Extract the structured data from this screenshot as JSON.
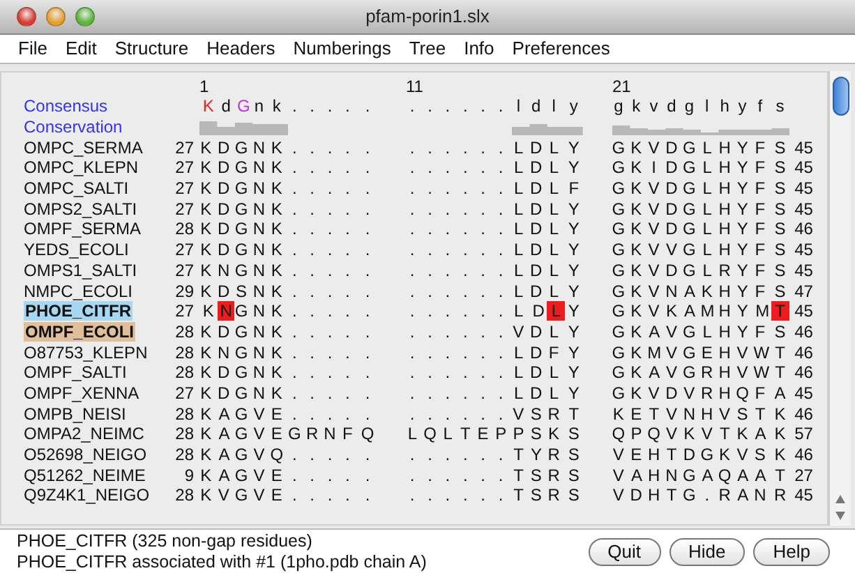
{
  "window": {
    "title": "pfam-porin1.slx"
  },
  "menu": [
    "File",
    "Edit",
    "Structure",
    "Headers",
    "Numberings",
    "Tree",
    "Info",
    "Preferences"
  ],
  "ruler": [
    "1",
    "11",
    "21"
  ],
  "consensus": {
    "label": "Consensus",
    "blocks": [
      [
        {
          "text": "K",
          "color": "#ee2222"
        },
        {
          "text": "d"
        },
        {
          "text": "G",
          "color": "#bb33dd"
        },
        {
          "text": "n k . . . . ."
        }
      ],
      [
        {
          "text": ". . . . . . l d l y"
        }
      ],
      [
        {
          "text": "g k v d g l h y f s"
        }
      ]
    ]
  },
  "conservation": {
    "label": "Conservation"
  },
  "rows": [
    {
      "name": "OMPC_SERMA",
      "start": "27",
      "blocks": [
        [
          {
            "text": "K D G N K . . . . ."
          }
        ],
        [
          {
            "text": ". . . . . . L D L Y"
          }
        ],
        [
          {
            "text": "G K V D G L H Y F S"
          }
        ]
      ],
      "end": "45"
    },
    {
      "name": "OMPC_KLEPN",
      "start": "27",
      "blocks": [
        [
          {
            "text": "K D G N K . . . . ."
          }
        ],
        [
          {
            "text": ". . . . . . L D L Y"
          }
        ],
        [
          {
            "text": "G K I D G L H Y F S"
          }
        ]
      ],
      "end": "45"
    },
    {
      "name": "OMPC_SALTI",
      "start": "27",
      "blocks": [
        [
          {
            "text": "K D G N K . . . . ."
          }
        ],
        [
          {
            "text": ". . . . . . L D L F"
          }
        ],
        [
          {
            "text": "G K V D G L H Y F S"
          }
        ]
      ],
      "end": "45"
    },
    {
      "name": "OMPS2_SALTI",
      "start": "27",
      "blocks": [
        [
          {
            "text": "K D G N K . . . . ."
          }
        ],
        [
          {
            "text": ". . . . . . L D L Y"
          }
        ],
        [
          {
            "text": "G K V D G L H Y F S"
          }
        ]
      ],
      "end": "45"
    },
    {
      "name": "OMPF_SERMA",
      "start": "28",
      "blocks": [
        [
          {
            "text": "K D G N K . . . . ."
          }
        ],
        [
          {
            "text": ". . . . . . L D L Y"
          }
        ],
        [
          {
            "text": "G K V D G L H Y F S"
          }
        ]
      ],
      "end": "46"
    },
    {
      "name": "YEDS_ECOLI",
      "start": "27",
      "blocks": [
        [
          {
            "text": "K D G N K . . . . ."
          }
        ],
        [
          {
            "text": ". . . . . . L D L Y"
          }
        ],
        [
          {
            "text": "G K V V G L H Y F S"
          }
        ]
      ],
      "end": "45"
    },
    {
      "name": "OMPS1_SALTI",
      "start": "27",
      "blocks": [
        [
          {
            "text": "K N G N K . . . . ."
          }
        ],
        [
          {
            "text": ". . . . . . L D L Y"
          }
        ],
        [
          {
            "text": "G K V D G L R Y F S"
          }
        ]
      ],
      "end": "45"
    },
    {
      "name": "NMPC_ECOLI",
      "start": "29",
      "blocks": [
        [
          {
            "text": "K D S N K . . . . ."
          }
        ],
        [
          {
            "text": ". . . . . . L D L Y"
          }
        ],
        [
          {
            "text": "G K V N A K H Y F S"
          }
        ]
      ],
      "end": "47"
    },
    {
      "name": "PHOE_CITFR",
      "color": "#a6d8f2",
      "start": "27",
      "blocks": [
        [
          {
            "text": "K"
          },
          {
            "text": "N",
            "highlighted": true
          },
          {
            "text": "G N K . . . . ."
          }
        ],
        [
          {
            "text": ". . . . . . L D"
          },
          {
            "text": "L",
            "highlighted": true
          },
          {
            "text": "Y"
          }
        ],
        [
          {
            "text": "G K V K A M H Y M"
          },
          {
            "text": "T",
            "highlighted": true
          }
        ]
      ],
      "end": "45"
    },
    {
      "name": "OMPF_ECOLI",
      "color": "#dfc09a",
      "start": "28",
      "blocks": [
        [
          {
            "text": "K D G N K . . . . ."
          }
        ],
        [
          {
            "text": ". . . . . . V D L Y"
          }
        ],
        [
          {
            "text": "G K A V G L H Y F S"
          }
        ]
      ],
      "end": "46"
    },
    {
      "name": "O87753_KLEPN",
      "start": "28",
      "blocks": [
        [
          {
            "text": "K N G N K . . . . ."
          }
        ],
        [
          {
            "text": ". . . . . . L D F Y"
          }
        ],
        [
          {
            "text": "G K M V G E H V W T"
          }
        ]
      ],
      "end": "46"
    },
    {
      "name": "OMPF_SALTI",
      "start": "28",
      "blocks": [
        [
          {
            "text": "K D G N K . . . . ."
          }
        ],
        [
          {
            "text": ". . . . . . L D L Y"
          }
        ],
        [
          {
            "text": "G K A V G R H V W T"
          }
        ]
      ],
      "end": "46"
    },
    {
      "name": "OMPF_XENNA",
      "start": "27",
      "blocks": [
        [
          {
            "text": "K D G N K . . . . ."
          }
        ],
        [
          {
            "text": ". . . . . . L D L Y"
          }
        ],
        [
          {
            "text": "G K V D V R H Q F A"
          }
        ]
      ],
      "end": "45"
    },
    {
      "name": "OMPB_NEISI",
      "start": "28",
      "blocks": [
        [
          {
            "text": "K A G V E . . . . ."
          }
        ],
        [
          {
            "text": ". . . . . . V S R T"
          }
        ],
        [
          {
            "text": "K E T V N H V S T K"
          }
        ]
      ],
      "end": "46"
    },
    {
      "name": "OMPA2_NEIMC",
      "start": "28",
      "blocks": [
        [
          {
            "text": "K A G V E G R N F Q"
          }
        ],
        [
          {
            "text": "L Q L T E P P S K S"
          }
        ],
        [
          {
            "text": "Q P Q V K V T K A K"
          }
        ]
      ],
      "end": "57"
    },
    {
      "name": "O52698_NEIGO",
      "start": "28",
      "blocks": [
        [
          {
            "text": "K A G V Q . . . . ."
          }
        ],
        [
          {
            "text": ". . . . . . T Y R S"
          }
        ],
        [
          {
            "text": "V E H T D G K V S K"
          }
        ]
      ],
      "end": "46"
    },
    {
      "name": "Q51262_NEIME",
      "start": "9",
      "blocks": [
        [
          {
            "text": "K A G V E . . . . ."
          }
        ],
        [
          {
            "text": ". . . . . . T S R S"
          }
        ],
        [
          {
            "text": "V A H N G A Q A A T"
          }
        ]
      ],
      "end": "27"
    },
    {
      "name": "Q9Z4K1_NEIGO",
      "start": "28",
      "blocks": [
        [
          {
            "text": "K V G V E . . . . ."
          }
        ],
        [
          {
            "text": ". . . . . . T S R S"
          }
        ],
        [
          {
            "text": "V D H T G . R A N R"
          }
        ]
      ],
      "end": "45"
    }
  ],
  "status": [
    "PHOE_CITFR (325 non-gap residues)",
    "PHOE_CITFR associated with #1 (1pho.pdb chain A)"
  ],
  "buttons": [
    "Quit",
    "Hide",
    "Help"
  ]
}
